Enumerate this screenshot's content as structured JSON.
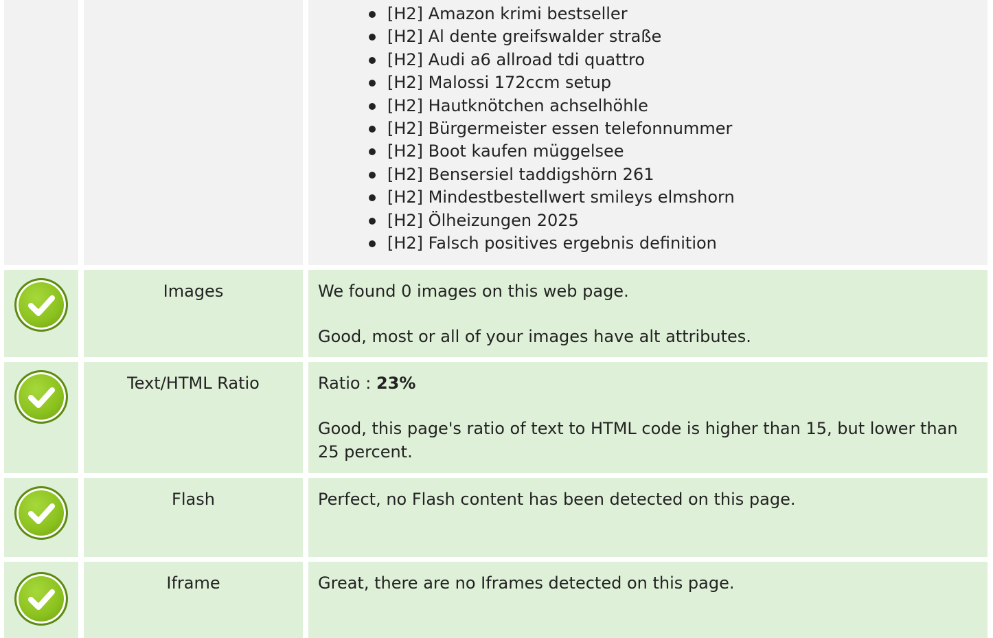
{
  "headings": {
    "items": [
      "[H2] Amazon krimi bestseller",
      "[H2] Al dente greifswalder straße",
      "[H2] Audi a6 allroad tdi quattro",
      "[H2] Malossi 172ccm setup",
      "[H2] Hautknötchen achselhöhle",
      "[H2] Bürgermeister essen telefonnummer",
      "[H2] Boot kaufen müggelsee",
      "[H2] Bensersiel taddigshörn 261",
      "[H2] Mindestbestellwert smileys elmshorn",
      "[H2] Ölheizungen 2025",
      "[H2] Falsch positives ergebnis definition"
    ]
  },
  "images": {
    "label": "Images",
    "line1": "We found 0 images on this web page.",
    "line2": "Good, most or all of your images have alt attributes.",
    "status_icon": "check-circle-icon"
  },
  "ratio": {
    "label": "Text/HTML Ratio",
    "prefix": "Ratio : ",
    "value": "23%",
    "line2": "Good, this page's ratio of text to HTML code is higher than 15, but lower than 25 percent.",
    "status_icon": "check-circle-icon"
  },
  "flash": {
    "label": "Flash",
    "line1": "Perfect, no Flash content has been detected on this page.",
    "status_icon": "check-circle-icon"
  },
  "iframe": {
    "label": "Iframe",
    "line1": "Great, there are no Iframes detected on this page.",
    "status_icon": "check-circle-icon"
  },
  "colors": {
    "good_row_bg": "#dff0d8",
    "neutral_row_bg": "#f2f2f2",
    "check_green": "#8cc21f"
  }
}
